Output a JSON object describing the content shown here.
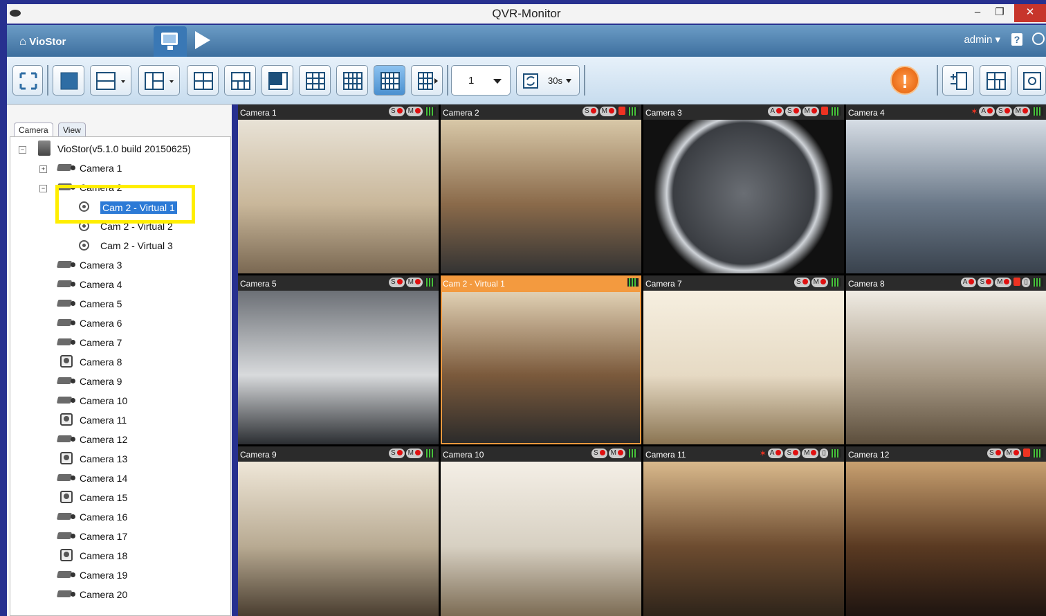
{
  "window": {
    "title": "QVR-Monitor",
    "minimize": "–",
    "restore": "❐",
    "close": "✕"
  },
  "header": {
    "home_label": "VioStor",
    "user": "admin ▾",
    "help": "?"
  },
  "toolbar": {
    "page_number": "1",
    "sequence_interval": "30s",
    "alert_symbol": "!"
  },
  "tabs": [
    "Camera",
    "View"
  ],
  "tree": {
    "server": "VioStor(v5.1.0 build 20150625)",
    "cameras": [
      "Camera 1",
      "Camera 2",
      "Camera 3",
      "Camera 4",
      "Camera 5",
      "Camera 6",
      "Camera 7",
      "Camera 8",
      "Camera 9",
      "Camera 10",
      "Camera 11",
      "Camera 12",
      "Camera 13",
      "Camera 14",
      "Camera 15",
      "Camera 16",
      "Camera 17",
      "Camera 18",
      "Camera 19",
      "Camera 20"
    ],
    "virtual": [
      "Cam 2 - Virtual 1",
      "Cam 2 - Virtual 2",
      "Cam 2 - Virtual 3"
    ],
    "selected": "Cam 2 - Virtual 1"
  },
  "grid": [
    {
      "name": "Camera 1",
      "badges": [
        "S",
        "M"
      ]
    },
    {
      "name": "Camera 2",
      "badges": [
        "S",
        "M",
        "alarm"
      ]
    },
    {
      "name": "Camera 3",
      "badges": [
        "A",
        "S",
        "M",
        "alarm"
      ]
    },
    {
      "name": "Camera 4",
      "badges": [
        "runner",
        "A",
        "S",
        "M"
      ]
    },
    {
      "name": "Camera 5",
      "badges": [
        "S",
        "M"
      ]
    },
    {
      "name": "Cam 2 - Virtual 1",
      "badges": []
    },
    {
      "name": "Camera 7",
      "badges": [
        "S",
        "M"
      ]
    },
    {
      "name": "Camera 8",
      "badges": [
        "A",
        "S",
        "M",
        "alarm",
        "io"
      ]
    },
    {
      "name": "Camera 9",
      "badges": [
        "S",
        "M"
      ]
    },
    {
      "name": "Camera 10",
      "badges": [
        "S",
        "M"
      ]
    },
    {
      "name": "Camera 11",
      "badges": [
        "runner",
        "A",
        "S",
        "M",
        "io"
      ]
    },
    {
      "name": "Camera 12",
      "badges": [
        "S",
        "M",
        "alarm"
      ]
    }
  ],
  "colors": {
    "accent": "#f39a3f",
    "selection": "#2c7ad6",
    "highlight": "#ffee00",
    "alert": "#e25c05"
  }
}
